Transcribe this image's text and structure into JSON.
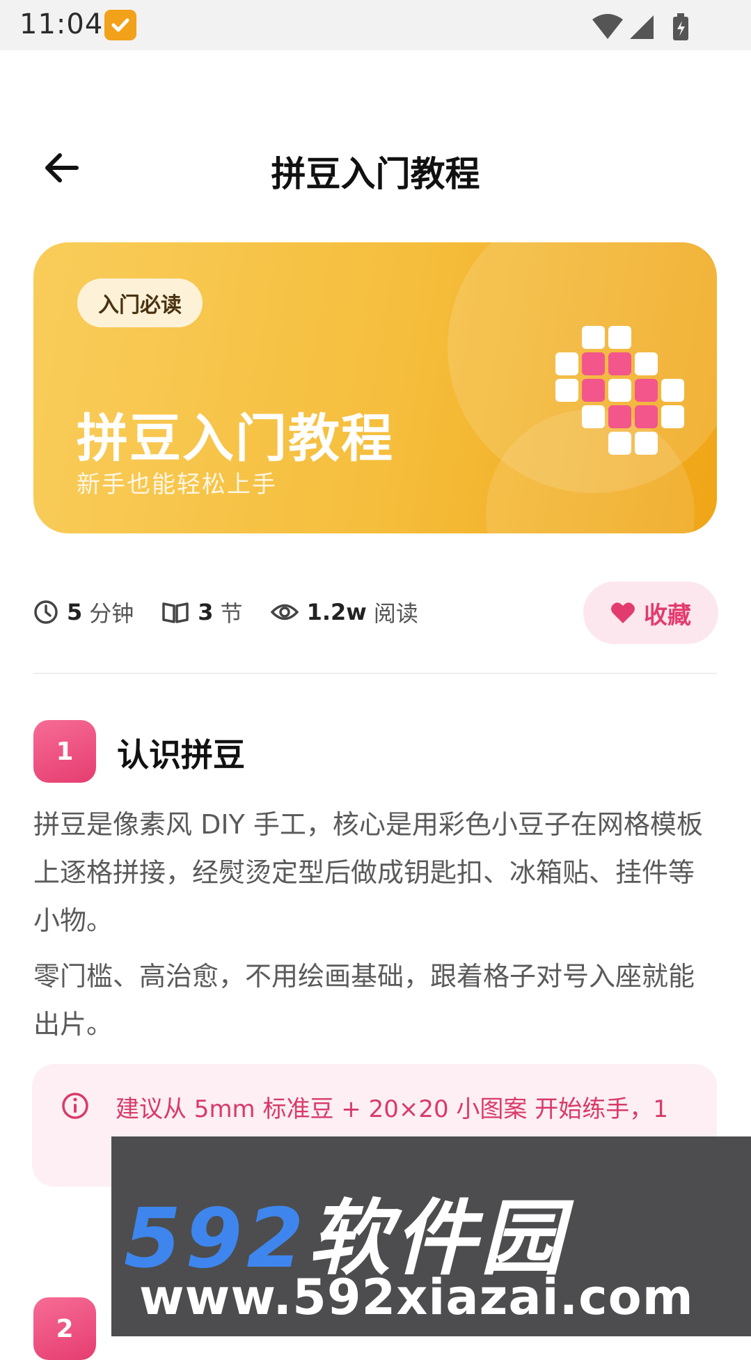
{
  "status_bar": {
    "time": "11:04",
    "icons": [
      "notification-check-icon",
      "wifi-icon",
      "signal-icon",
      "battery-charging-icon"
    ]
  },
  "header": {
    "title": "拼豆入门教程",
    "back_icon": "arrow-left-icon"
  },
  "banner": {
    "tag": "入门必读",
    "title": "拼豆入门教程",
    "subtitle": "新手也能轻松上手",
    "colors": {
      "gradient_start": "#f9cd5b",
      "gradient_end": "#efa516",
      "pixel_pink": "#f2568a",
      "pixel_white": "#ffffff"
    }
  },
  "meta": {
    "duration": {
      "value": "5",
      "unit": "分钟",
      "icon": "clock-icon"
    },
    "sections": {
      "value": "3",
      "unit": "节",
      "icon": "book-icon"
    },
    "reads": {
      "value": "1.2w",
      "unit": "阅读",
      "icon": "eye-icon"
    },
    "favorite": {
      "label": "收藏",
      "icon": "heart-icon",
      "color": "#e23c6e"
    }
  },
  "section1": {
    "number": "1",
    "title": "认识拼豆",
    "paragraphs": [
      "拼豆是像素风 DIY 手工，核心是用彩色小豆子在网格模板上逐格拼接，经熨烫定型后做成钥匙扣、冰箱贴、挂件等小物。",
      "零门槛、高治愈，不用绘画基础，跟着格子对号入座就能出片。"
    ],
    "tip": {
      "icon": "info-icon",
      "text": "建议从 5mm 标准豆 + 20×20 小图案 开始练手，1"
    }
  },
  "section2": {
    "number": "2"
  },
  "watermark": {
    "logo_number": "592",
    "logo_text": "软件园",
    "url": "www.592xiazai.com"
  }
}
